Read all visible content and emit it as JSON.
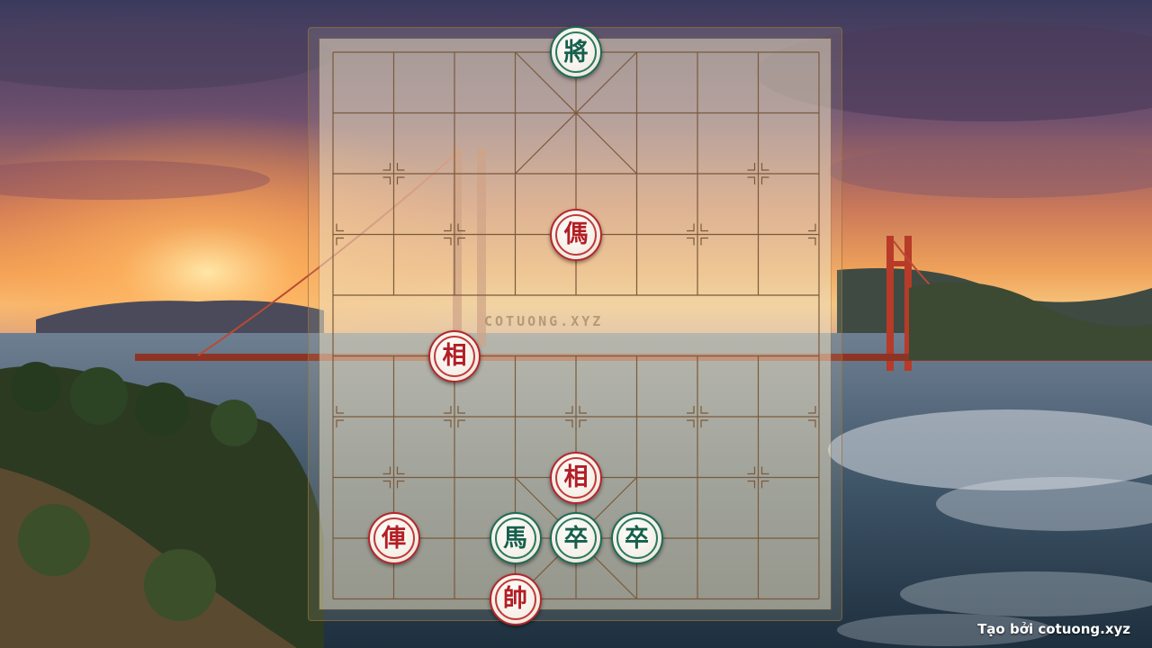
{
  "board": {
    "watermark": "COTUONG.XYZ",
    "columns": 9,
    "rows": 10
  },
  "pieces": [
    {
      "char": "將",
      "side": "green",
      "col": 4,
      "row": 0
    },
    {
      "char": "傌",
      "side": "red",
      "col": 4,
      "row": 3
    },
    {
      "char": "相",
      "side": "red",
      "col": 2,
      "row": 5
    },
    {
      "char": "相",
      "side": "red",
      "col": 4,
      "row": 7
    },
    {
      "char": "俥",
      "side": "red",
      "col": 1,
      "row": 8
    },
    {
      "char": "馬",
      "side": "green",
      "col": 3,
      "row": 8
    },
    {
      "char": "卒",
      "side": "green",
      "col": 4,
      "row": 8
    },
    {
      "char": "卒",
      "side": "green",
      "col": 5,
      "row": 8
    },
    {
      "char": "帥",
      "side": "red",
      "col": 3,
      "row": 9
    }
  ],
  "credit": "Tạo bởi cotuong.xyz",
  "colors": {
    "red_piece": "#b21f24",
    "green_piece": "#17604b",
    "grid_line": "#7a5a3c"
  }
}
